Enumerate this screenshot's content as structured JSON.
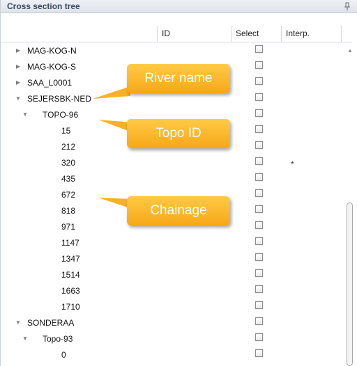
{
  "panel": {
    "title": "Cross section tree",
    "pin_icon": "pin-icon"
  },
  "columns": {
    "id": "ID",
    "select": "Select",
    "interp": "Interp."
  },
  "rows": [
    {
      "label": "MAG-KOG-N",
      "level": 0,
      "expander": "collapsed",
      "interp": ""
    },
    {
      "label": "MAG-KOG-S",
      "level": 0,
      "expander": "collapsed",
      "interp": ""
    },
    {
      "label": "SAA_L0001",
      "level": 0,
      "expander": "collapsed",
      "interp": ""
    },
    {
      "label": "SEJERSBK-NED",
      "level": 0,
      "expander": "expanded",
      "interp": ""
    },
    {
      "label": "TOPO-96",
      "level": 1,
      "expander": "expanded",
      "interp": ""
    },
    {
      "label": "15",
      "level": 2,
      "expander": "none",
      "interp": ""
    },
    {
      "label": "212",
      "level": 2,
      "expander": "none",
      "interp": ""
    },
    {
      "label": "320",
      "level": 2,
      "expander": "none",
      "interp": "*"
    },
    {
      "label": "435",
      "level": 2,
      "expander": "none",
      "interp": ""
    },
    {
      "label": "672",
      "level": 2,
      "expander": "none",
      "interp": ""
    },
    {
      "label": "818",
      "level": 2,
      "expander": "none",
      "interp": ""
    },
    {
      "label": "971",
      "level": 2,
      "expander": "none",
      "interp": ""
    },
    {
      "label": "1147",
      "level": 2,
      "expander": "none",
      "interp": ""
    },
    {
      "label": "1347",
      "level": 2,
      "expander": "none",
      "interp": ""
    },
    {
      "label": "1514",
      "level": 2,
      "expander": "none",
      "interp": ""
    },
    {
      "label": "1663",
      "level": 2,
      "expander": "none",
      "interp": ""
    },
    {
      "label": "1710",
      "level": 2,
      "expander": "none",
      "interp": ""
    },
    {
      "label": "SONDERAA",
      "level": 0,
      "expander": "expanded",
      "interp": ""
    },
    {
      "label": "Topo-93",
      "level": 1,
      "expander": "expanded",
      "interp": ""
    },
    {
      "label": "0",
      "level": 2,
      "expander": "none",
      "interp": ""
    }
  ],
  "callouts": {
    "river": "River name",
    "topo": "Topo ID",
    "chainage": "Chainage"
  },
  "colors": {
    "callout": "#f9b52b",
    "title_text": "#3a4a63"
  }
}
